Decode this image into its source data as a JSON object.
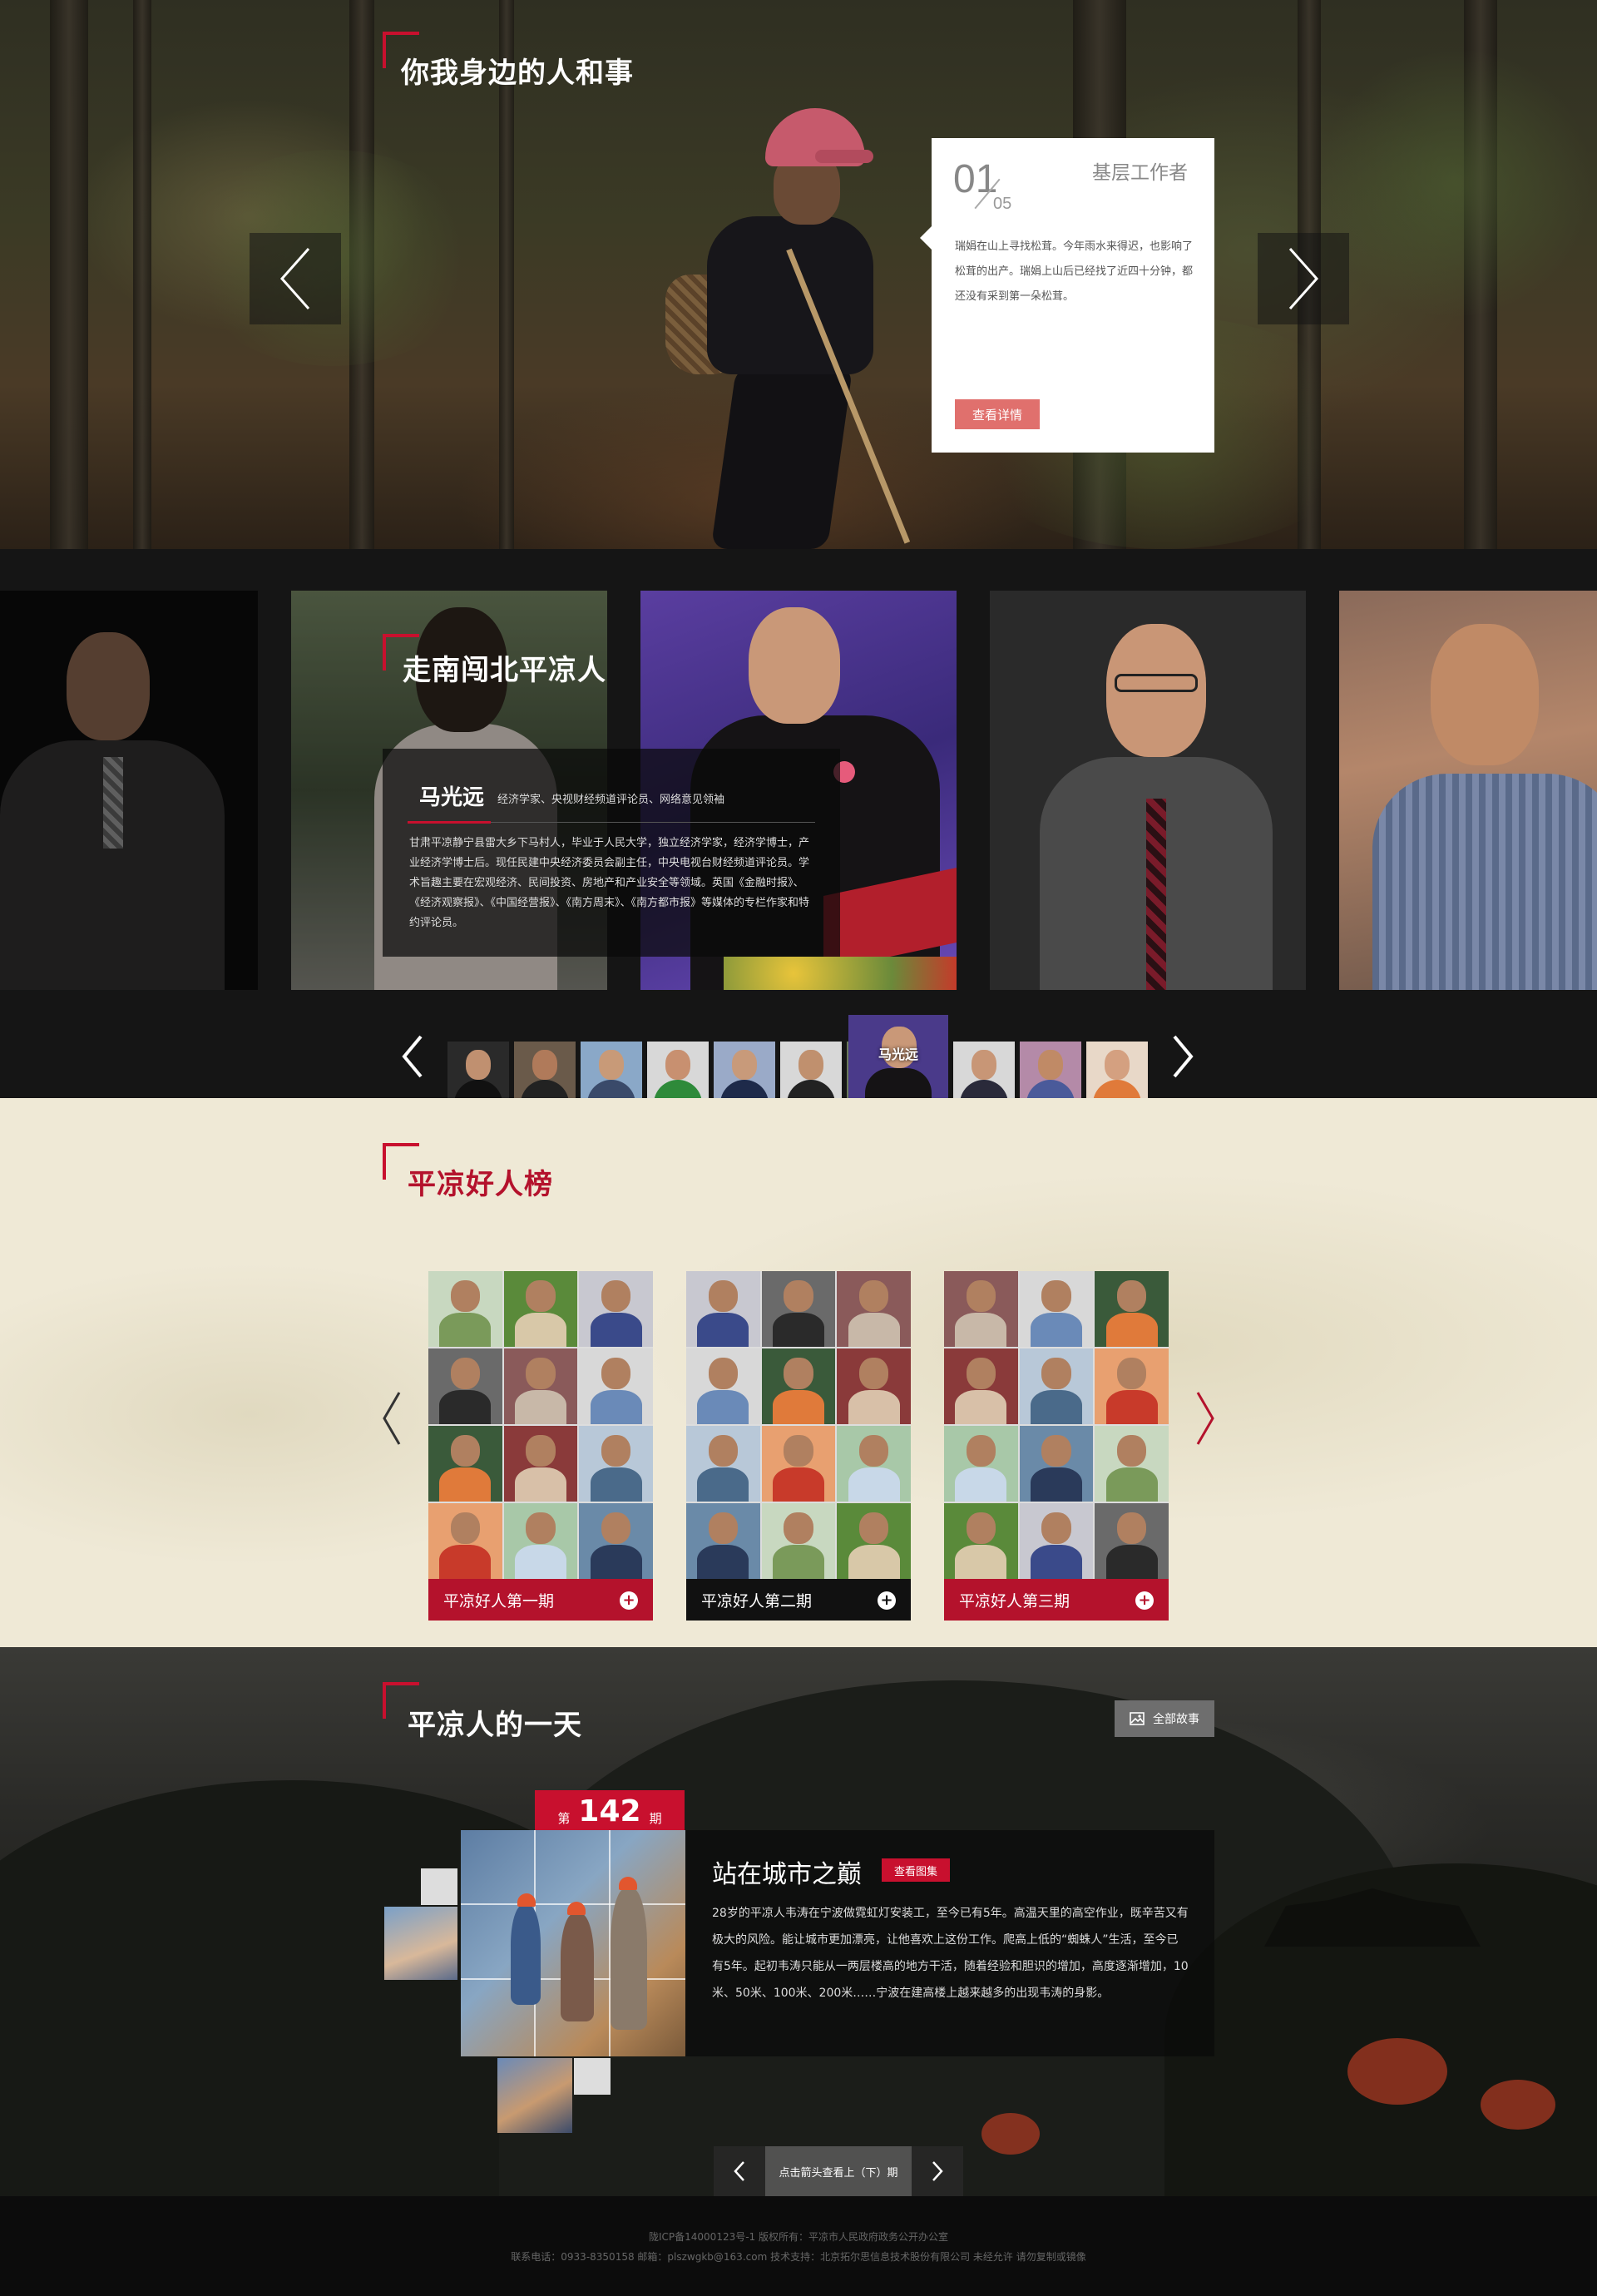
{
  "hero": {
    "section_title": "你我身边的人和事",
    "card": {
      "current": "01",
      "total": "05",
      "category": "基层工作者",
      "description": "瑞娟在山上寻找松茸。今年雨水来得迟，也影响了松茸的出产。瑞娟上山后已经找了近四十分钟，都还没有采到第一朵松茸。",
      "button_label": "查看详情"
    }
  },
  "people": {
    "section_title": "走南闯北平凉人",
    "featured": {
      "name": "马光远",
      "title": "经济学家、央视财经频道评论员、网络意见领袖",
      "description": "甘肃平凉静宁县雷大乡下马村人，毕业于人民大学，独立经济学家，经济学博士，产业经济学博士后。现任民建中央经济委员会副主任，中央电视台财经频道评论员。学术旨趣主要在宏观经济、民间投资、房地产和产业安全等领域。英国《金融时报》、《经济观察报》、《中国经营报》、《南方周末》、《南方都市报》等媒体的专栏作家和特约评论员。"
    },
    "active_thumb_label": "马光远"
  },
  "good": {
    "section_title": "平凉好人榜",
    "cards": [
      {
        "label": "平凉好人第一期"
      },
      {
        "label": "平凉好人第二期"
      },
      {
        "label": "平凉好人第三期"
      }
    ]
  },
  "day": {
    "section_title": "平凉人的一天",
    "all_stories_label": "全部故事",
    "issue_prefix": "第",
    "issue_number": "142",
    "issue_suffix": "期",
    "story_title": "站在城市之巅",
    "gallery_button": "查看图集",
    "story_description": "28岁的平凉人韦涛在宁波做霓虹灯安装工，至今已有5年。高温天里的高空作业，既辛苦又有极大的风险。能让城市更加漂亮，让他喜欢上这份工作。爬高上低的“蜘蛛人”生活，至今已有5年。起初韦涛只能从一两层楼高的地方干活，随着经验和胆识的增加，高度逐渐增加，10米、50米、100米、200米……宁波在建高楼上越来越多的出现韦涛的身影。",
    "nav_text": "点击箭头查看上（下）期"
  },
  "footer": {
    "line1": "陇ICP备14000123号-1 版权所有：平凉市人民政府政务公开办公室",
    "line2": "联系电话：0933-8350158 邮箱：plszwgkb@163.com 技术支持：北京拓尔思信息技术股份有限公司 未经允许 请勿复制或镜像"
  },
  "colors": {
    "accent_red": "#c8102e",
    "hero_button": "#e0706d",
    "good_background": "#efe9d6"
  }
}
